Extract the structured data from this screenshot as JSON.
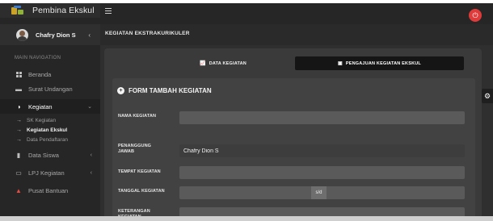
{
  "app": {
    "title": "Pembina Ekskul",
    "user_name": "Chafry Dion S"
  },
  "sidebar": {
    "header": "MAIN NAVIGATION",
    "items": [
      {
        "label": "Beranda",
        "icon": "dashboard-grid-icon"
      },
      {
        "label": "Surat Undangan",
        "icon": "mail-icon"
      },
      {
        "label": "Kegiatan",
        "icon": "circle-half-icon",
        "active": true
      },
      {
        "label": "Data Siswa",
        "icon": "book-icon"
      },
      {
        "label": "LPJ Kegiatan",
        "icon": "report-icon"
      },
      {
        "label": "Pusat Bantuan",
        "icon": "warning-triangle-icon"
      }
    ],
    "sub_items": [
      {
        "label": "SK Kegiatan"
      },
      {
        "label": "Kegiatan Ekskul",
        "current": true
      },
      {
        "label": "Data Pendaftaran"
      }
    ]
  },
  "breadcrumb": "KEGIATAN EKSTRAKURIKULER",
  "tabs": {
    "data": "DATA KEGIATAN",
    "pengajuan": "PENGAJUAN KEGIATAN EKSKUL"
  },
  "form": {
    "title": "FORM TAMBAH KEGIATAN",
    "fields": {
      "nama": {
        "label": "NAMA KEGIATAN",
        "value": ""
      },
      "penanggung_1": "PENANGGUNG",
      "penanggung_2": "JAWAB",
      "penanggung_value": "Chafry Dion S",
      "tempat": {
        "label": "TEMPAT KEGIATAN",
        "value": ""
      },
      "tanggal": {
        "label": "TANGGAL KEGIATAN",
        "separator": "s/d"
      },
      "keterangan_1": "KETERANGAN",
      "keterangan_2": "KEGIATAN"
    }
  },
  "colors": {
    "accent_power": "#e03b3b",
    "sidebar_bg": "#262626",
    "danger_icon": "#e84a3f"
  }
}
